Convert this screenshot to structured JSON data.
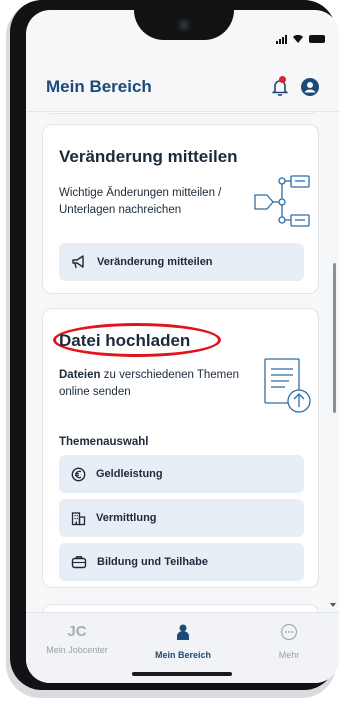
{
  "header": {
    "title": "Mein Bereich"
  },
  "card_change": {
    "title": "Veränderung mitteilen",
    "text_line1": "Wichtige Änderungen mitteilen /",
    "text_line2": "Unterlagen nachreichen",
    "button_label": "Veränderung mitteilen"
  },
  "card_upload": {
    "title": "Datei hochladen",
    "text_bold": "Dateien",
    "text_rest_line1": " zu verschiedenen Themen",
    "text_line2": "online senden",
    "section_label": "Themenauswahl",
    "topics": [
      {
        "label": "Geldleistung",
        "icon": "euro-icon"
      },
      {
        "label": "Vermittlung",
        "icon": "building-icon"
      },
      {
        "label": "Bildung und Teilhabe",
        "icon": "briefcase-icon"
      }
    ]
  },
  "nav": {
    "items": [
      {
        "label": "Mein Jobcenter",
        "icon": "jc-logo-icon",
        "active": false
      },
      {
        "label": "Mein Bereich",
        "icon": "person-icon",
        "active": true
      },
      {
        "label": "Mehr",
        "icon": "more-icon",
        "active": false
      }
    ],
    "jc_logo_text": "JC"
  },
  "colors": {
    "brand": "#1d4a78",
    "highlight": "#e2141b",
    "notification_dot": "#e0202d"
  }
}
